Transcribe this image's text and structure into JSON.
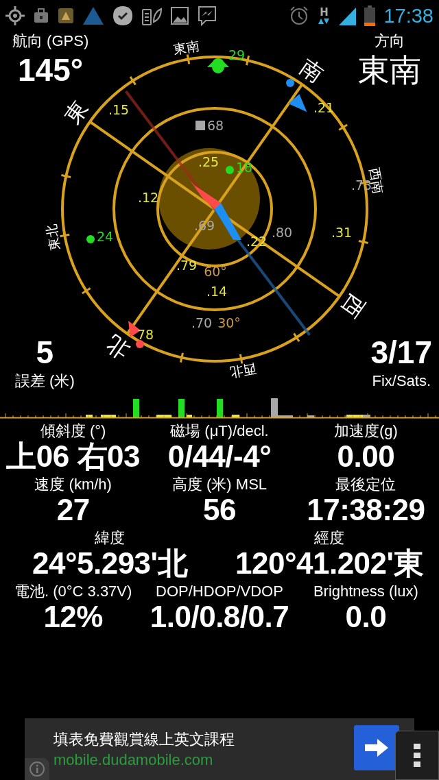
{
  "status_bar": {
    "network_type": "H",
    "time": "17:38"
  },
  "heading": {
    "label": "航向 (GPS)",
    "value": "145°"
  },
  "direction": {
    "label": "方向",
    "value": "東南"
  },
  "compass": {
    "directions": [
      "北",
      "東北",
      "東",
      "東南",
      "南",
      "西南",
      "西",
      "西北"
    ],
    "ring_labels": [
      "60°",
      "30°"
    ],
    "satellites": [
      {
        "label": "29",
        "color": "#22dd22",
        "kind": "bell"
      },
      {
        "label": ".15",
        "color": "#e6e640",
        "kind": "none"
      },
      {
        "label": "68",
        "color": "#a8a8a8",
        "kind": "square"
      },
      {
        "label": ".25",
        "color": "#e6e640",
        "kind": "none"
      },
      {
        "label": "18",
        "color": "#22dd22",
        "kind": "dot"
      },
      {
        "label": ".12",
        "color": "#e6e640",
        "kind": "none"
      },
      {
        "label": ".73",
        "color": "#a8a8a8",
        "kind": "none"
      },
      {
        "label": ".21",
        "color": "#e6e640",
        "kind": "none"
      },
      {
        "label": "24",
        "color": "#22dd22",
        "kind": "dot"
      },
      {
        "label": ".69",
        "color": "#a8a8a8",
        "kind": "none"
      },
      {
        "label": ".80",
        "color": "#a8a8a8",
        "kind": "none"
      },
      {
        "label": ".22",
        "color": "#e6e640",
        "kind": "none"
      },
      {
        "label": ".31",
        "color": "#e6e640",
        "kind": "none"
      },
      {
        "label": ".79",
        "color": "#e6e640",
        "kind": "none"
      },
      {
        "label": ".14",
        "color": "#e6e640",
        "kind": "none"
      },
      {
        "label": ".70",
        "color": "#a8a8a8",
        "kind": "none"
      },
      {
        "label": "78",
        "color": "#e6e640",
        "kind": "none"
      }
    ]
  },
  "accuracy": {
    "value": "5",
    "label": "誤差 (米)"
  },
  "fix": {
    "value": "3/17",
    "label": "Fix/Sats."
  },
  "stats": [
    [
      {
        "label": "傾斜度 (°)",
        "value": "上06 右03"
      },
      {
        "label": "磁場 (μT)/decl.",
        "value": "0/44/-4°"
      },
      {
        "label": "加速度(g)",
        "value": "0.00"
      }
    ],
    [
      {
        "label": "速度 (km/h)",
        "value": "27"
      },
      {
        "label": "高度 (米) MSL",
        "value": "56"
      },
      {
        "label": "最後定位",
        "value": "17:38:29"
      }
    ],
    [
      {
        "label": "緯度",
        "value": "24°5.293'北"
      },
      {
        "label": "經度",
        "value": "120°41.202'東"
      }
    ],
    [
      {
        "label": "電池. (0°C 3.37V)",
        "value": "12%"
      },
      {
        "label": "DOP/HDOP/VDOP",
        "value": "1.0/0.8/0.7"
      },
      {
        "label": "Brightness (lux)",
        "value": "0.0"
      }
    ]
  ],
  "ad": {
    "title": "填表免費觀賞線上英文課程",
    "url": "mobile.dudamobile.com"
  }
}
